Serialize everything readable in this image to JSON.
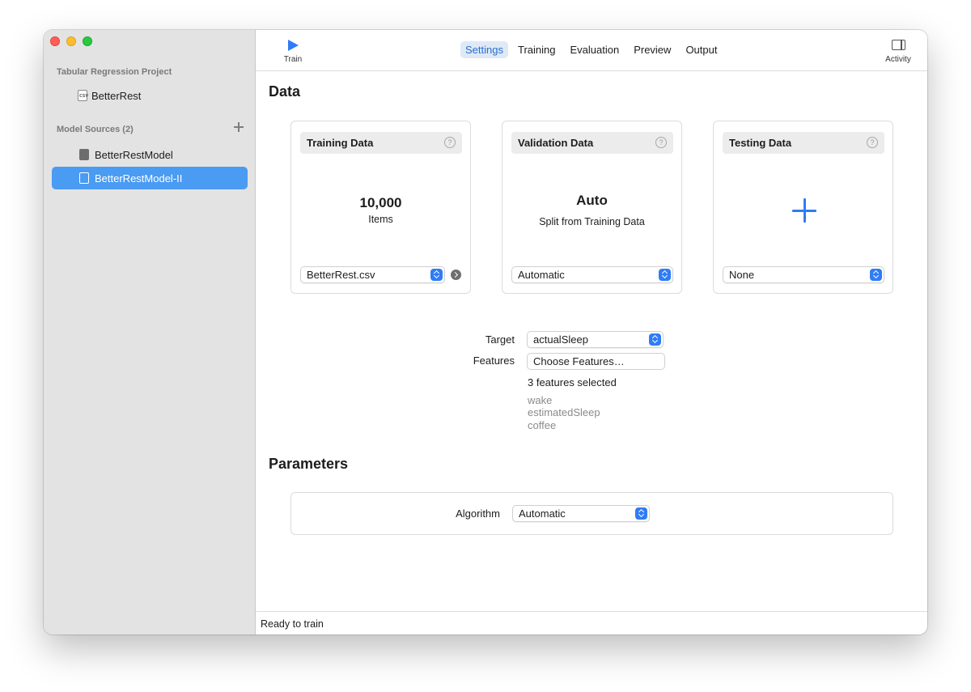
{
  "sidebar": {
    "project_header": "Tabular Regression Project",
    "project_item": "BetterRest",
    "project_item_icon": "csv-document-icon",
    "sources_header": "Model Sources (2)",
    "add_icon": "plus-icon",
    "sources": [
      {
        "label": "BetterRestModel",
        "icon": "model-icon",
        "selected": false
      },
      {
        "label": "BetterRestModel-II",
        "icon": "model-icon",
        "selected": true
      }
    ]
  },
  "toolbar": {
    "train_label": "Train",
    "activity_label": "Activity",
    "tabs": [
      {
        "label": "Settings",
        "active": true
      },
      {
        "label": "Training",
        "active": false
      },
      {
        "label": "Evaluation",
        "active": false
      },
      {
        "label": "Preview",
        "active": false
      },
      {
        "label": "Output",
        "active": false
      }
    ]
  },
  "data_section": {
    "title": "Data",
    "training": {
      "title": "Training Data",
      "count": "10,000",
      "count_label": "Items",
      "source": "BetterRest.csv"
    },
    "validation": {
      "title": "Validation Data",
      "value": "Auto",
      "description": "Split from Training Data",
      "source": "Automatic"
    },
    "testing": {
      "title": "Testing Data",
      "source": "None"
    }
  },
  "target_features": {
    "target_label": "Target",
    "target_value": "actualSleep",
    "features_label": "Features",
    "features_button": "Choose Features…",
    "features_count": "3 features selected",
    "features": [
      "wake",
      "estimatedSleep",
      "coffee"
    ]
  },
  "parameters": {
    "title": "Parameters",
    "algorithm_label": "Algorithm",
    "algorithm_value": "Automatic"
  },
  "status": "Ready to train",
  "colors": {
    "accent": "#2f7cf6",
    "selection": "#4a9bf2",
    "sidebar_bg": "#e3e3e3"
  }
}
